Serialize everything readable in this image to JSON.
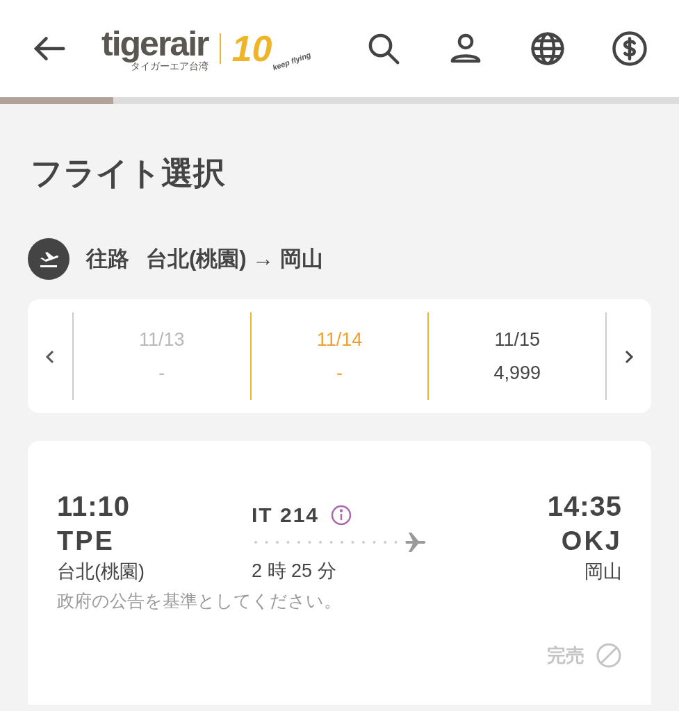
{
  "header": {
    "logo": {
      "wordmark": "tigerair",
      "subtitle": "タイガーエア台湾",
      "anniversary": "10",
      "tagline": "keep flying"
    }
  },
  "progress": {
    "level": 0.167
  },
  "title": "フライト選択",
  "route": {
    "direction": "往路",
    "text": "台北(桃園) → 岡山"
  },
  "dates": [
    {
      "date": "11/13",
      "price": "-",
      "selected": false,
      "disabled": true
    },
    {
      "date": "11/14",
      "price": "-",
      "selected": true,
      "disabled": false
    },
    {
      "date": "11/15",
      "price": "4,999",
      "selected": false,
      "disabled": false
    }
  ],
  "flight": {
    "departure": {
      "time": "11:10",
      "code": "TPE",
      "city": "台北(桃園)"
    },
    "flight_number": "IT 214",
    "duration": "2 時 25 分",
    "arrival": {
      "time": "14:35",
      "code": "OKJ",
      "city": "岡山"
    },
    "note": "政府の公告を基準としてください。",
    "status": "完売",
    "sold_out": true
  }
}
